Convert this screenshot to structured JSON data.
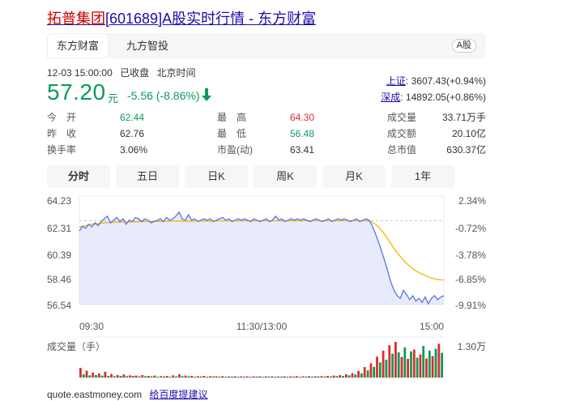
{
  "page_title": {
    "name": "拓普集团",
    "rest": "[601689]A股实时行情 - 东方财富"
  },
  "source_tabs": [
    {
      "label": "东方财富",
      "active": true
    },
    {
      "label": "九方智投",
      "active": false
    }
  ],
  "market_badge": "A股",
  "quote": {
    "datetime": "12-03 15:00:00",
    "status": "已收盘",
    "timezone": "北京时间",
    "price": "57.20",
    "currency": "元",
    "change": "-5.56 (-8.86%)",
    "direction_icon": "arrow-down-icon"
  },
  "indexes": [
    {
      "label": "上证",
      "value": ": 3607.43(+0.94%)"
    },
    {
      "label": "深成",
      "value": ": 14892.05(+0.86%)"
    }
  ],
  "stats": {
    "col1": [
      {
        "label": "今　开",
        "value": "62.44",
        "color": "#0a9b58"
      },
      {
        "label": "昨　收",
        "value": "62.76",
        "color": "#333333"
      },
      {
        "label": "换手率",
        "value": "3.06%",
        "color": "#333333"
      }
    ],
    "col2": [
      {
        "label": "最　高",
        "value": "64.30",
        "color": "#e02b2b"
      },
      {
        "label": "最　低",
        "value": "56.48",
        "color": "#0a9b58"
      },
      {
        "label": "市盈(动)",
        "value": "63.41",
        "color": "#333333"
      }
    ],
    "col3": [
      {
        "label": "成交量",
        "value": "33.71万手"
      },
      {
        "label": "成交额",
        "value": "20.10亿"
      },
      {
        "label": "总市值",
        "value": "630.37亿"
      }
    ]
  },
  "period_tabs": [
    {
      "label": "分时",
      "active": true
    },
    {
      "label": "五日",
      "active": false
    },
    {
      "label": "日K",
      "active": false
    },
    {
      "label": "周K",
      "active": false
    },
    {
      "label": "月K",
      "active": false
    },
    {
      "label": "1年",
      "active": false
    }
  ],
  "chart_data": {
    "type": "line",
    "y_left_ticks": [
      "64.23",
      "62.31",
      "60.39",
      "58.46",
      "56.54"
    ],
    "y_right_ticks": [
      "2.34%",
      "-0.72%",
      "-3.78%",
      "-6.85%",
      "-9.91%"
    ],
    "x_ticks": [
      "09:30",
      "11:30/13:00",
      "15:00"
    ],
    "ylim": [
      56.54,
      64.23
    ],
    "prev_close": 62.76,
    "price": [
      62.0,
      62.35,
      62.2,
      62.5,
      62.3,
      62.6,
      62.4,
      62.7,
      62.9,
      63.1,
      62.6,
      62.8,
      63.0,
      62.7,
      62.9,
      62.5,
      62.8,
      62.7,
      63.0,
      62.9,
      62.7,
      62.9,
      62.8,
      62.6,
      62.7,
      62.8,
      62.9,
      62.7,
      63.0,
      62.8,
      62.9,
      63.1,
      63.4,
      62.9,
      62.8,
      63.2,
      62.8,
      62.9,
      62.7,
      62.8,
      62.9,
      62.8,
      62.9,
      62.7,
      62.8,
      62.9,
      63.0,
      62.8,
      62.9,
      62.7,
      62.8,
      62.9,
      62.8,
      62.9,
      62.8,
      62.7,
      62.9,
      62.8,
      62.7,
      62.8,
      62.9,
      62.7,
      62.8,
      63.1,
      62.8,
      62.9,
      62.7,
      62.8,
      62.9,
      62.8,
      62.9,
      62.8,
      62.9,
      62.8,
      62.7,
      62.8,
      62.9,
      62.8,
      62.7,
      62.8,
      62.9,
      62.7,
      62.8,
      62.9,
      62.8,
      62.9,
      62.8,
      62.7,
      62.8,
      62.9,
      62.7,
      62.8,
      62.9,
      62.8,
      62.4,
      61.8,
      61.2,
      60.5,
      59.8,
      59.0,
      58.2,
      57.6,
      57.2,
      57.0,
      57.6,
      57.3,
      56.9,
      57.2,
      56.8,
      57.0,
      56.7,
      57.1,
      56.6,
      57.0,
      57.2,
      56.9,
      57.1,
      57.2
    ],
    "avg": [
      62.3,
      62.35,
      62.4,
      62.45,
      62.5,
      62.52,
      62.55,
      62.58,
      62.6,
      62.62,
      62.63,
      62.64,
      62.65,
      62.66,
      62.66,
      62.67,
      62.67,
      62.68,
      62.68,
      62.69,
      62.69,
      62.7,
      62.7,
      62.7,
      62.71,
      62.71,
      62.71,
      62.72,
      62.72,
      62.72,
      62.72,
      62.73,
      62.73,
      62.73,
      62.73,
      62.73,
      62.74,
      62.74,
      62.74,
      62.74,
      62.74,
      62.74,
      62.74,
      62.75,
      62.75,
      62.75,
      62.75,
      62.75,
      62.75,
      62.75,
      62.75,
      62.75,
      62.76,
      62.76,
      62.76,
      62.76,
      62.76,
      62.76,
      62.76,
      62.76,
      62.76,
      62.76,
      62.76,
      62.76,
      62.76,
      62.76,
      62.76,
      62.76,
      62.76,
      62.76,
      62.76,
      62.76,
      62.76,
      62.76,
      62.76,
      62.76,
      62.76,
      62.76,
      62.76,
      62.76,
      62.76,
      62.76,
      62.76,
      62.76,
      62.76,
      62.76,
      62.76,
      62.76,
      62.76,
      62.76,
      62.76,
      62.76,
      62.76,
      62.74,
      62.65,
      62.5,
      62.3,
      62.05,
      61.75,
      61.4,
      61.05,
      60.7,
      60.4,
      60.1,
      59.85,
      59.6,
      59.4,
      59.2,
      59.05,
      58.9,
      58.8,
      58.7,
      58.6,
      58.5,
      58.45,
      58.4,
      58.38,
      58.36
    ],
    "volume_label": "成交量（手）",
    "volume_max_label": "1.30万",
    "volume_max": 13000,
    "volume": [
      3500,
      1200,
      2500,
      800,
      1800,
      900,
      1500,
      700,
      2100,
      600,
      1300,
      500,
      900,
      600,
      1100,
      500,
      800,
      600,
      700,
      400,
      900,
      500,
      600,
      400,
      700,
      300,
      500,
      400,
      600,
      300,
      800,
      400,
      1200,
      500,
      700,
      400,
      600,
      300,
      500,
      400,
      600,
      300,
      500,
      400,
      450,
      350,
      500,
      300,
      400,
      350,
      450,
      300,
      400,
      350,
      450,
      300,
      400,
      350,
      450,
      300,
      400,
      350,
      450,
      300,
      400,
      350,
      450,
      300,
      400,
      350,
      500,
      300,
      450,
      350,
      500,
      300,
      450,
      400,
      500,
      350,
      600,
      400,
      700,
      500,
      900,
      600,
      1200,
      800,
      1600,
      1100,
      2400,
      1500,
      3800,
      2600,
      5200,
      3900,
      7600,
      5500,
      9800,
      6500,
      11800,
      8700,
      13000,
      9200,
      7500,
      11000,
      6800,
      9500,
      10200,
      7200,
      8400,
      11500,
      6900,
      9800,
      7800,
      10500,
      12300,
      9000
    ],
    "volume_up": [
      true,
      false,
      true,
      false,
      true,
      false,
      true,
      false,
      true,
      false,
      true,
      false,
      true,
      false,
      true,
      false,
      true,
      false,
      true,
      false,
      true,
      false,
      true,
      false,
      true,
      false,
      true,
      false,
      true,
      false,
      true,
      false,
      true,
      false,
      true,
      false,
      true,
      false,
      true,
      false,
      true,
      false,
      true,
      false,
      true,
      false,
      true,
      false,
      true,
      false,
      true,
      false,
      true,
      false,
      true,
      false,
      true,
      false,
      true,
      false,
      true,
      false,
      true,
      false,
      true,
      false,
      true,
      false,
      true,
      false,
      true,
      false,
      true,
      false,
      true,
      false,
      true,
      false,
      true,
      false,
      true,
      false,
      true,
      false,
      true,
      false,
      true,
      false,
      true,
      false,
      true,
      false,
      true,
      false,
      true,
      false,
      true,
      false,
      true,
      false,
      true,
      false,
      true,
      false,
      true,
      false,
      true,
      false,
      true,
      false,
      true,
      false,
      true,
      false,
      true,
      false,
      true,
      false
    ]
  },
  "footer": {
    "domain": "quote.eastmoney.com",
    "feedback_link": "给百度提建议"
  },
  "colors": {
    "up": "#e02b2b",
    "down": "#0a9b58",
    "price_line": "#5b73e8",
    "avg_line": "#f5b400",
    "link": "#1a0dab"
  }
}
